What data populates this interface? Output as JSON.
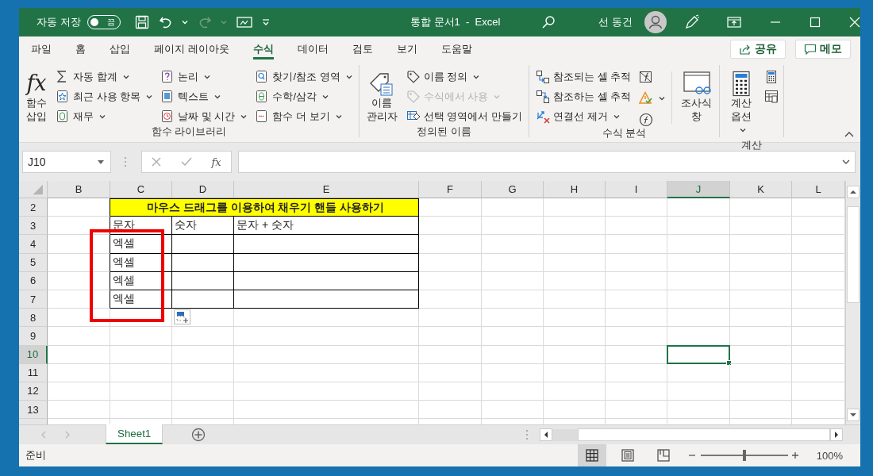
{
  "title_bar": {
    "autosave_label": "자동 저장",
    "autosave": {
      "label": "끔",
      "on": false
    },
    "document": "통합 문서1  -  Excel",
    "user": "선 동건"
  },
  "ribbon_tabs": [
    {
      "label": "파일",
      "selected": false
    },
    {
      "label": "홈",
      "selected": false
    },
    {
      "label": "삽입",
      "selected": false
    },
    {
      "label": "페이지 레이아웃",
      "selected": false
    },
    {
      "label": "수식",
      "selected": true
    },
    {
      "label": "데이터",
      "selected": false
    },
    {
      "label": "검토",
      "selected": false
    },
    {
      "label": "보기",
      "selected": false
    },
    {
      "label": "도움말",
      "selected": false
    }
  ],
  "ribbon_buttons": [
    "공유",
    "메모"
  ],
  "ribbon_groups": [
    {
      "label": "함수 라이브러리",
      "parts": [
        {
          "kind": "large",
          "label": "함수 삽입",
          "glyph": "fx",
          "menu": false
        },
        {
          "kind": "column",
          "items": [
            {
              "label": "자동 합계",
              "menu": true,
              "disabled": false
            },
            {
              "label": "최근 사용 항목",
              "menu": true,
              "disabled": false
            },
            {
              "label": "재무",
              "menu": true,
              "disabled": false
            }
          ]
        },
        {
          "kind": "column",
          "items": [
            {
              "label": "논리",
              "menu": true,
              "disabled": false
            },
            {
              "label": "텍스트",
              "menu": true,
              "disabled": false
            },
            {
              "label": "날짜 및 시간",
              "menu": true,
              "disabled": false
            }
          ]
        },
        {
          "kind": "column",
          "items": [
            {
              "label": "찾기/참조 영역",
              "menu": true,
              "disabled": false
            },
            {
              "label": "수학/삼각",
              "menu": true,
              "disabled": false
            },
            {
              "label": "함수 더 보기",
              "menu": true,
              "disabled": false
            }
          ]
        }
      ]
    },
    {
      "label": "정의된 이름",
      "parts": [
        {
          "kind": "large",
          "label": "이름 관리자",
          "menu": false
        },
        {
          "kind": "column",
          "items": [
            {
              "label": "이름 정의",
              "menu": true,
              "disabled": false
            },
            {
              "label": "수식에서 사용",
              "menu": true,
              "disabled": true
            },
            {
              "label": "선택 영역에서 만들기",
              "menu": false,
              "disabled": false
            }
          ]
        }
      ]
    },
    {
      "label": "수식 분석",
      "parts": [
        {
          "kind": "column",
          "items": [
            {
              "label": "참조되는 셀 추적",
              "menu": false,
              "disabled": false
            },
            {
              "label": "참조하는 셀 추적",
              "menu": false,
              "disabled": false
            },
            {
              "label": "연결선 제거",
              "menu": true,
              "disabled": false
            }
          ]
        },
        {
          "kind": "icons",
          "items": [
            {
              "menu": false
            },
            {
              "menu": true
            },
            {
              "menu": false
            }
          ]
        },
        {
          "kind": "large",
          "label": "조사식 창",
          "menu": false
        }
      ]
    },
    {
      "label": "계산",
      "parts": [
        {
          "kind": "large",
          "label": "계산 옵션",
          "menu": true
        },
        {
          "kind": "icons",
          "items": [
            {
              "menu": false
            },
            {
              "menu": false
            }
          ]
        }
      ]
    }
  ],
  "formula_bar": {
    "name_box": "J10",
    "glyph": "fx"
  },
  "columns": [
    {
      "label": "B",
      "selected": false
    },
    {
      "label": "C",
      "selected": false
    },
    {
      "label": "D",
      "selected": false
    },
    {
      "label": "E",
      "selected": false
    },
    {
      "label": "F",
      "selected": false
    },
    {
      "label": "G",
      "selected": false
    },
    {
      "label": "H",
      "selected": false
    },
    {
      "label": "I",
      "selected": false
    },
    {
      "label": "J",
      "selected": true
    },
    {
      "label": "K",
      "selected": false
    },
    {
      "label": "L",
      "selected": false
    }
  ],
  "rows": [
    {
      "label": "2",
      "selected": false
    },
    {
      "label": "3",
      "selected": false
    },
    {
      "label": "4",
      "selected": false
    },
    {
      "label": "5",
      "selected": false
    },
    {
      "label": "6",
      "selected": false
    },
    {
      "label": "7",
      "selected": false
    },
    {
      "label": "8",
      "selected": false
    },
    {
      "label": "9",
      "selected": false
    },
    {
      "label": "10",
      "selected": true
    },
    {
      "label": "11",
      "selected": false
    },
    {
      "label": "12",
      "selected": false
    },
    {
      "label": "13",
      "selected": false
    }
  ],
  "table": {
    "title": "마우스 드래그를 이용하여 채우기 핸들 사용하기",
    "headers": [
      "문자",
      "숫자",
      "문자 + 숫자"
    ],
    "rows": [
      {
        "text": "엑셀"
      },
      {
        "text": "엑셀"
      },
      {
        "text": "엑셀"
      },
      {
        "text": "엑셀"
      }
    ]
  },
  "annotation": {
    "kind": "frame",
    "color": "#ee0000"
  },
  "sheet_tabs": [
    {
      "label": "Sheet1",
      "selected": true
    }
  ],
  "status_bar": {
    "status": "준비",
    "views": [
      {
        "selected": true
      },
      {
        "selected": false
      },
      {
        "selected": false
      }
    ],
    "zoom": {
      "level": 0.5,
      "reading": "100%"
    }
  }
}
